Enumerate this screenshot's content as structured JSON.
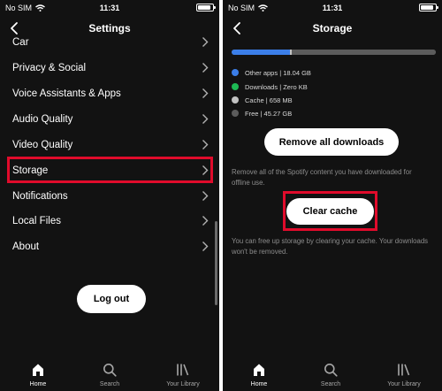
{
  "status_bar": {
    "carrier": "No SIM",
    "time": "11:31",
    "battery_level": 0.85
  },
  "settings_screen": {
    "title": "Settings",
    "items": [
      {
        "label": "Car"
      },
      {
        "label": "Privacy & Social"
      },
      {
        "label": "Voice Assistants & Apps"
      },
      {
        "label": "Audio Quality"
      },
      {
        "label": "Video Quality"
      },
      {
        "label": "Storage",
        "highlighted": true
      },
      {
        "label": "Notifications"
      },
      {
        "label": "Local Files"
      },
      {
        "label": "About"
      }
    ],
    "logout_label": "Log out"
  },
  "storage_screen": {
    "title": "Storage",
    "usage_fractions": {
      "other_apps": 0.285,
      "downloads": 0.0,
      "cache": 0.01,
      "free": 0.705
    },
    "legend": [
      {
        "label": "Other apps | 18.04 GB",
        "color": "#3b7ee8"
      },
      {
        "label": "Downloads | Zero KB",
        "color": "#1db954"
      },
      {
        "label": "Cache | 658 MB",
        "color": "#c2c2c2"
      },
      {
        "label": "Free | 45.27 GB",
        "color": "#5c5c5c"
      }
    ],
    "remove_downloads_label": "Remove all downloads",
    "remove_description": "Remove all of the Spotify content you have downloaded for offline use.",
    "clear_cache_label": "Clear cache",
    "cache_description": "You can free up storage by clearing your cache. Your downloads won't be removed."
  },
  "tab_bar": {
    "tabs": [
      {
        "label": "Home",
        "icon": "home-icon",
        "active": true
      },
      {
        "label": "Search",
        "icon": "search-icon",
        "active": false
      },
      {
        "label": "Your Library",
        "icon": "library-icon",
        "active": false
      }
    ]
  },
  "colors": {
    "background": "#121212",
    "highlight": "#e00b2b",
    "accent": "#1db954"
  }
}
